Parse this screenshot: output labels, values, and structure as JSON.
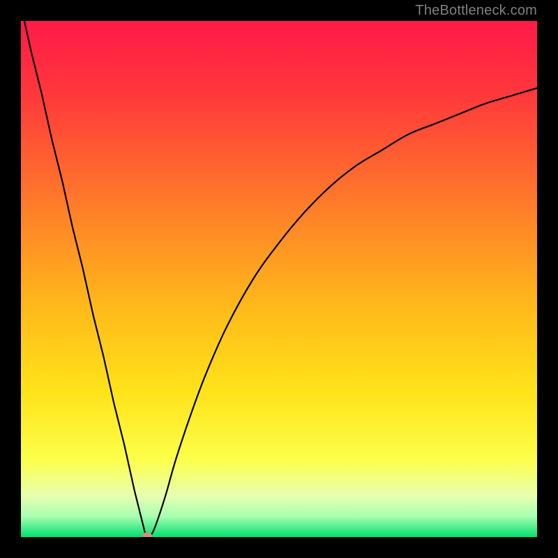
{
  "watermark": "TheBottleneck.com",
  "chart_data": {
    "type": "line",
    "title": "",
    "xlabel": "",
    "ylabel": "",
    "xlim": [
      0,
      100
    ],
    "ylim": [
      0,
      100
    ],
    "x": [
      0,
      2,
      4,
      6,
      8,
      10,
      12,
      14,
      16,
      18,
      20,
      22,
      23,
      23.5,
      24,
      24.5,
      25,
      26,
      28,
      30,
      33,
      36,
      40,
      45,
      50,
      55,
      60,
      65,
      70,
      75,
      80,
      85,
      90,
      95,
      100
    ],
    "values": [
      103,
      94,
      86,
      77,
      69,
      60,
      52,
      43,
      35,
      26,
      18,
      9,
      5,
      3,
      1,
      0.3,
      0,
      2,
      8,
      15,
      24,
      32,
      41,
      50,
      57,
      63,
      68,
      72,
      75,
      78,
      80,
      82,
      84,
      85.5,
      87
    ],
    "marker": {
      "x": 24.5,
      "y": 0.3
    },
    "gradient_stops": [
      {
        "offset": 0,
        "color": "#ff1a4a"
      },
      {
        "offset": 0.15,
        "color": "#ff3a3a"
      },
      {
        "offset": 0.35,
        "color": "#ff7a2a"
      },
      {
        "offset": 0.55,
        "color": "#ffb81a"
      },
      {
        "offset": 0.72,
        "color": "#ffe31a"
      },
      {
        "offset": 0.85,
        "color": "#fcff4a"
      },
      {
        "offset": 0.92,
        "color": "#e8ffb0"
      },
      {
        "offset": 0.96,
        "color": "#a8ffb0"
      },
      {
        "offset": 1.0,
        "color": "#00e070"
      }
    ]
  }
}
